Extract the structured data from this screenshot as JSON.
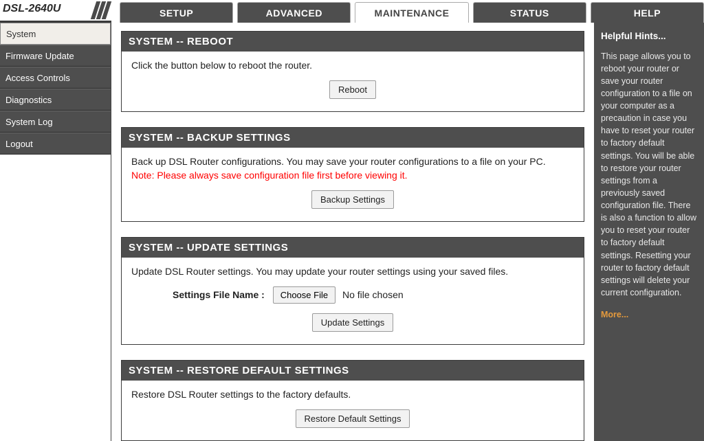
{
  "product_model": "DSL-2640U",
  "tabs": [
    {
      "label": "SETUP",
      "active": false
    },
    {
      "label": "ADVANCED",
      "active": false
    },
    {
      "label": "MAINTENANCE",
      "active": true
    },
    {
      "label": "STATUS",
      "active": false
    },
    {
      "label": "HELP",
      "active": false
    }
  ],
  "sidebar": [
    {
      "label": "System",
      "active": true
    },
    {
      "label": "Firmware Update",
      "active": false
    },
    {
      "label": "Access Controls",
      "active": false
    },
    {
      "label": "Diagnostics",
      "active": false
    },
    {
      "label": "System Log",
      "active": false
    },
    {
      "label": "Logout",
      "active": false
    }
  ],
  "panels": {
    "reboot": {
      "title": "SYSTEM -- REBOOT",
      "text": "Click the button below to reboot the router.",
      "button": "Reboot"
    },
    "backup": {
      "title": "SYSTEM -- BACKUP SETTINGS",
      "text": "Back up DSL Router configurations. You may save your router configurations to a file on your PC.",
      "note": "Note: Please always save configuration file first before viewing it.",
      "button": "Backup Settings"
    },
    "update": {
      "title": "SYSTEM -- UPDATE SETTINGS",
      "text": "Update DSL Router settings. You may update your router settings using your saved files.",
      "file_label": "Settings File Name :",
      "choose_button": "Choose File",
      "file_status": "No file chosen",
      "button": "Update Settings"
    },
    "restore": {
      "title": "SYSTEM -- RESTORE DEFAULT SETTINGS",
      "text": "Restore DSL Router settings to the factory defaults.",
      "button": "Restore Default Settings"
    }
  },
  "help": {
    "title": "Helpful Hints...",
    "body": "This page allows you to reboot your router or save your router configuration to a file on your computer as a precaution in case you have to reset your router to factory default settings. You will be able to restore your router settings from a previously saved configuration file. There is also a function to allow you to reset your router to factory default settings. Resetting your router to factory default settings will delete your current configuration.",
    "more": "More..."
  }
}
